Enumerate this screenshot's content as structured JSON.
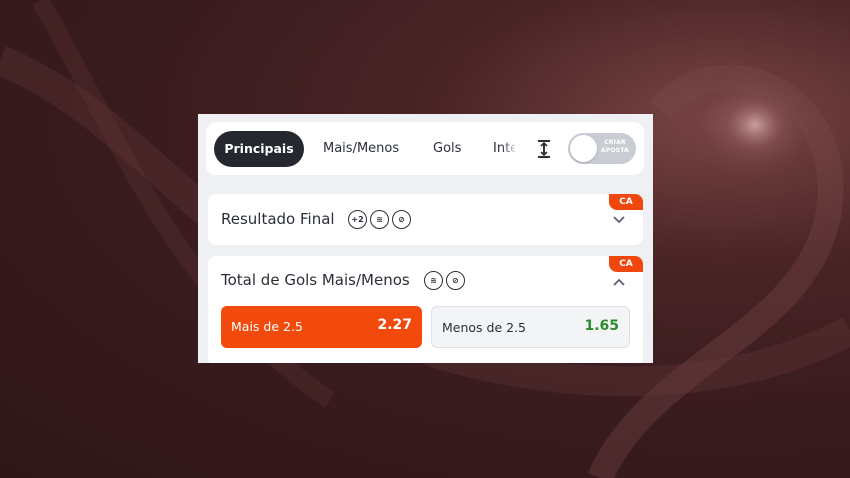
{
  "tabs": [
    {
      "label": "Principais",
      "active": true
    },
    {
      "label": "Mais/Menos",
      "active": false
    },
    {
      "label": "Gols",
      "active": false
    },
    {
      "label": "Intervalo",
      "active": false
    }
  ],
  "toggle": {
    "label_line1": "CRIAR",
    "label_line2": "APOSTA",
    "on": false
  },
  "icons": {
    "height": "vertical-resize-icon",
    "expand": "chevron-down-icon",
    "collapse": "chevron-up-icon"
  },
  "markets": [
    {
      "title": "Resultado Final",
      "badge": "CA",
      "badge_icons": [
        "+2",
        "≋",
        "⊘"
      ],
      "expanded": false
    },
    {
      "title": "Total de Gols Mais/Menos",
      "badge": "CA",
      "badge_icons": [
        "≋",
        "⊘"
      ],
      "expanded": true,
      "selections": [
        {
          "label": "Mais de 2.5",
          "odds": "2.27",
          "selected": true
        },
        {
          "label": "Menos de 2.5",
          "odds": "1.65",
          "selected": false
        }
      ]
    }
  ],
  "colors": {
    "accent": "#f24a0c",
    "active_tab": "#25282e",
    "odds_green": "#2c8a2c",
    "background": "#3a1c1f"
  }
}
